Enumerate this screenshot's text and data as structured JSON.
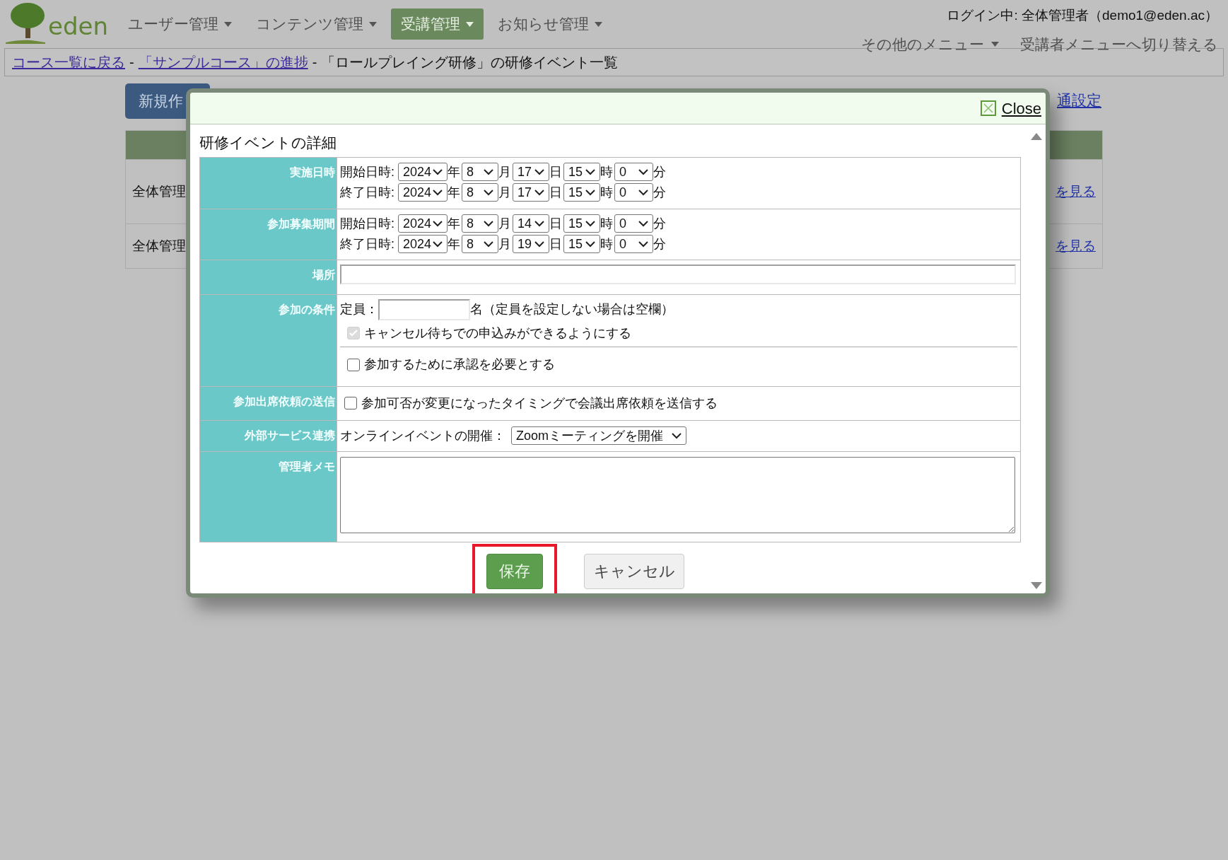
{
  "header": {
    "logo_text": "eden",
    "nav": [
      {
        "label": "ユーザー管理",
        "selected": false
      },
      {
        "label": "コンテンツ管理",
        "selected": false
      },
      {
        "label": "受講管理",
        "selected": true
      },
      {
        "label": "お知らせ管理",
        "selected": false
      }
    ],
    "login": "ログイン中: 全体管理者（demo1@eden.ac）",
    "other_menu": "その他のメニュー",
    "switch_menu": "受講者メニューへ切り替える"
  },
  "breadcrumb": [
    {
      "kind": "link",
      "text": "コース一覧に戻る"
    },
    {
      "kind": "text",
      "text": "-"
    },
    {
      "kind": "link",
      "text": "「サンプルコース」の進捗"
    },
    {
      "kind": "text",
      "text": "-"
    },
    {
      "kind": "text",
      "text": "「ロールプレイング研修」の研修イベント一覧"
    }
  ],
  "background": {
    "new_button": "新規作",
    "settings_link": "通設定",
    "rows": [
      {
        "cell": "全体管理",
        "link": "を見る"
      },
      {
        "cell": "全体管理",
        "link": "を見る"
      }
    ]
  },
  "modal": {
    "close": "Close",
    "heading": "研修イベントの詳細",
    "rows": [
      {
        "kind": "datetime",
        "label": "実施日時",
        "lines": [
          {
            "label": "開始日時:",
            "fields": [
              {
                "value": "2024",
                "unit": "年"
              },
              {
                "value": "8",
                "unit": "月"
              },
              {
                "value": "17",
                "unit": "日"
              },
              {
                "value": "15",
                "unit": "時"
              },
              {
                "value": "0",
                "unit": "分"
              }
            ]
          },
          {
            "label": "終了日時:",
            "fields": [
              {
                "value": "2024",
                "unit": "年"
              },
              {
                "value": "8",
                "unit": "月"
              },
              {
                "value": "17",
                "unit": "日"
              },
              {
                "value": "15",
                "unit": "時"
              },
              {
                "value": "0",
                "unit": "分"
              }
            ]
          }
        ]
      },
      {
        "kind": "datetime",
        "label": "参加募集期間",
        "lines": [
          {
            "label": "開始日時:",
            "fields": [
              {
                "value": "2024",
                "unit": "年"
              },
              {
                "value": "8",
                "unit": "月"
              },
              {
                "value": "14",
                "unit": "日"
              },
              {
                "value": "15",
                "unit": "時"
              },
              {
                "value": "0",
                "unit": "分"
              }
            ]
          },
          {
            "label": "終了日時:",
            "fields": [
              {
                "value": "2024",
                "unit": "年"
              },
              {
                "value": "8",
                "unit": "月"
              },
              {
                "value": "19",
                "unit": "日"
              },
              {
                "value": "15",
                "unit": "時"
              },
              {
                "value": "0",
                "unit": "分"
              }
            ]
          }
        ]
      },
      {
        "kind": "text_input",
        "label": "場所"
      },
      {
        "kind": "conditions",
        "label": "参加の条件",
        "capacity_label": "定員：",
        "capacity_note": "名（定員を設定しない場合は空欄）",
        "options": [
          {
            "label": "キャンセル待ちでの申込みができるようにする",
            "checked": true,
            "disabled": true
          },
          {
            "label": "参加するために承認を必要とする",
            "checked": false,
            "disabled": false
          }
        ]
      },
      {
        "kind": "checkbox",
        "label": "参加出席依頼の送信",
        "option": {
          "label": "参加可否が変更になったタイミングで会議出席依頼を送信する",
          "checked": false,
          "disabled": false
        }
      },
      {
        "kind": "select",
        "label": "外部サービス連携",
        "prefix": "オンラインイベントの開催：",
        "value": "Zoomミーティングを開催"
      },
      {
        "kind": "textarea",
        "label": "管理者メモ"
      }
    ],
    "buttons": [
      {
        "kind": "primary",
        "label": "保存",
        "highlighted": true
      },
      {
        "kind": "secondary",
        "label": "キャンセル"
      }
    ]
  }
}
